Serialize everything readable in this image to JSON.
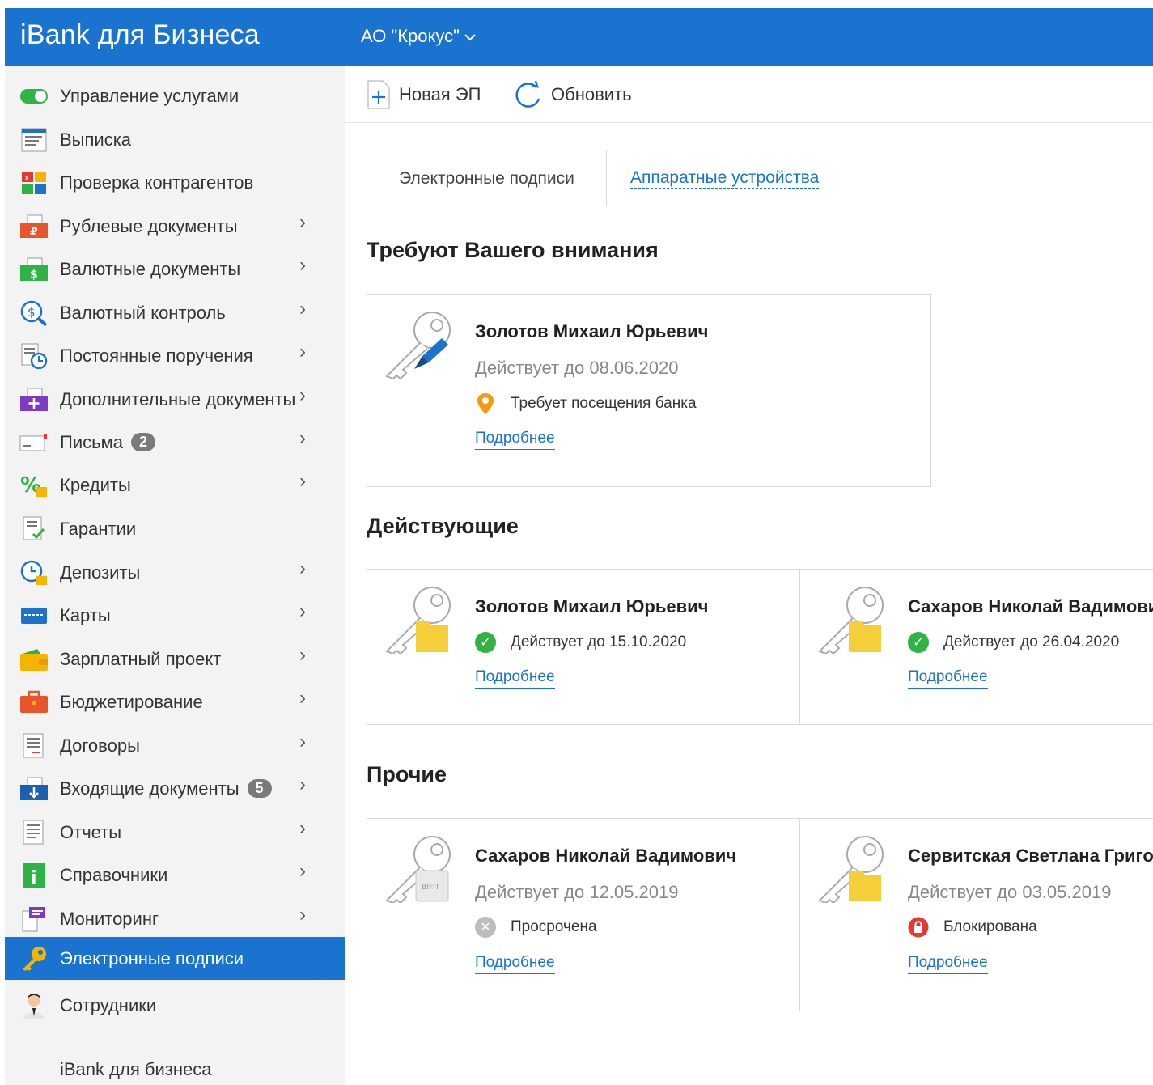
{
  "header": {
    "brand": "iBank для Бизнеса",
    "org": "АО \"Крокус\"",
    "org_chevron": "chevron-down-icon"
  },
  "sidebar": {
    "items": [
      {
        "label": "Управление услугами",
        "icon": "toggle-icon",
        "arrow": false
      },
      {
        "label": "Выписка",
        "icon": "statement-icon",
        "arrow": false
      },
      {
        "label": "Проверка контрагентов",
        "icon": "counterparty-check-icon",
        "arrow": false
      },
      {
        "label": "Рублевые документы",
        "icon": "ruble-documents-icon",
        "arrow": true
      },
      {
        "label": "Валютные документы",
        "icon": "currency-documents-icon",
        "arrow": true
      },
      {
        "label": "Валютный контроль",
        "icon": "currency-control-icon",
        "arrow": true
      },
      {
        "label": "Постоянные поручения",
        "icon": "standing-orders-icon",
        "arrow": true
      },
      {
        "label": "Дополнительные документы",
        "icon": "additional-documents-icon",
        "arrow": true
      },
      {
        "label": "Письма",
        "icon": "letters-icon",
        "arrow": true,
        "badge": "2"
      },
      {
        "label": "Кредиты",
        "icon": "credits-icon",
        "arrow": true
      },
      {
        "label": "Гарантии",
        "icon": "guarantees-icon",
        "arrow": false
      },
      {
        "label": "Депозиты",
        "icon": "deposits-icon",
        "arrow": true
      },
      {
        "label": "Карты",
        "icon": "cards-icon",
        "arrow": true
      },
      {
        "label": "Зарплатный проект",
        "icon": "wallet-icon",
        "arrow": true
      },
      {
        "label": "Бюджетирование",
        "icon": "briefcase-icon",
        "arrow": true
      },
      {
        "label": "Договоры",
        "icon": "contracts-icon",
        "arrow": true
      },
      {
        "label": "Входящие документы",
        "icon": "incoming-documents-icon",
        "arrow": true,
        "badge": "5"
      },
      {
        "label": "Отчеты",
        "icon": "reports-icon",
        "arrow": true
      },
      {
        "label": "Справочники",
        "icon": "info-icon",
        "arrow": true
      },
      {
        "label": "Мониторинг",
        "icon": "monitoring-icon",
        "arrow": true
      },
      {
        "label": "Электронные подписи",
        "icon": "key-icon",
        "arrow": false,
        "active": true
      },
      {
        "label": "Сотрудники",
        "icon": "employee-icon",
        "arrow": false
      }
    ],
    "footer": "iBank для бизнеса"
  },
  "toolbar": {
    "new_label": "Новая ЭП",
    "refresh_label": "Обновить"
  },
  "tabs": {
    "active": "Электронные подписи",
    "other": "Аппаратные устройства"
  },
  "sections": {
    "attention": {
      "title": "Требуют Вашего внимания",
      "cards": [
        {
          "name": "Золотов Михаил Юрьевич",
          "valid": "Действует до 08.06.2020",
          "status": "Требует посещения банка",
          "status_icon": "location-pin-icon",
          "more": "Подробнее",
          "key_type": "usb-token"
        }
      ]
    },
    "active": {
      "title": "Действующие",
      "cards": [
        {
          "name": "Золотов Михаил Юрьевич",
          "status": "Действует до 15.10.2020",
          "status_icon": "check-circle-icon",
          "more": "Подробнее",
          "key_type": "folder"
        },
        {
          "name": "Сахаров Николай Вадимович",
          "status": "Действует до 26.04.2020",
          "status_icon": "check-circle-icon",
          "more": "Подробнее",
          "key_type": "folder"
        }
      ]
    },
    "other": {
      "title": "Прочие",
      "cards": [
        {
          "name": "Сахаров Николай Вадимович",
          "valid": "Действует до 12.05.2019",
          "status": "Просрочена",
          "status_icon": "x-circle-icon",
          "more": "Подробнее",
          "key_type": "bifit-token",
          "token_label": "BIFIT"
        },
        {
          "name": "Сервитская Светлана Григорьевна",
          "valid": "Действует до 03.05.2019",
          "status": "Блокирована",
          "status_icon": "lock-icon",
          "more": "Подробнее",
          "key_type": "folder"
        }
      ]
    }
  },
  "colors": {
    "brand_blue": "#1a73cf",
    "sidebar_bg": "#f3f3f3",
    "ok_green": "#2fb344",
    "warn_orange": "#f39c12",
    "error_red": "#e53935",
    "muted_gray": "#9e9e9e"
  }
}
